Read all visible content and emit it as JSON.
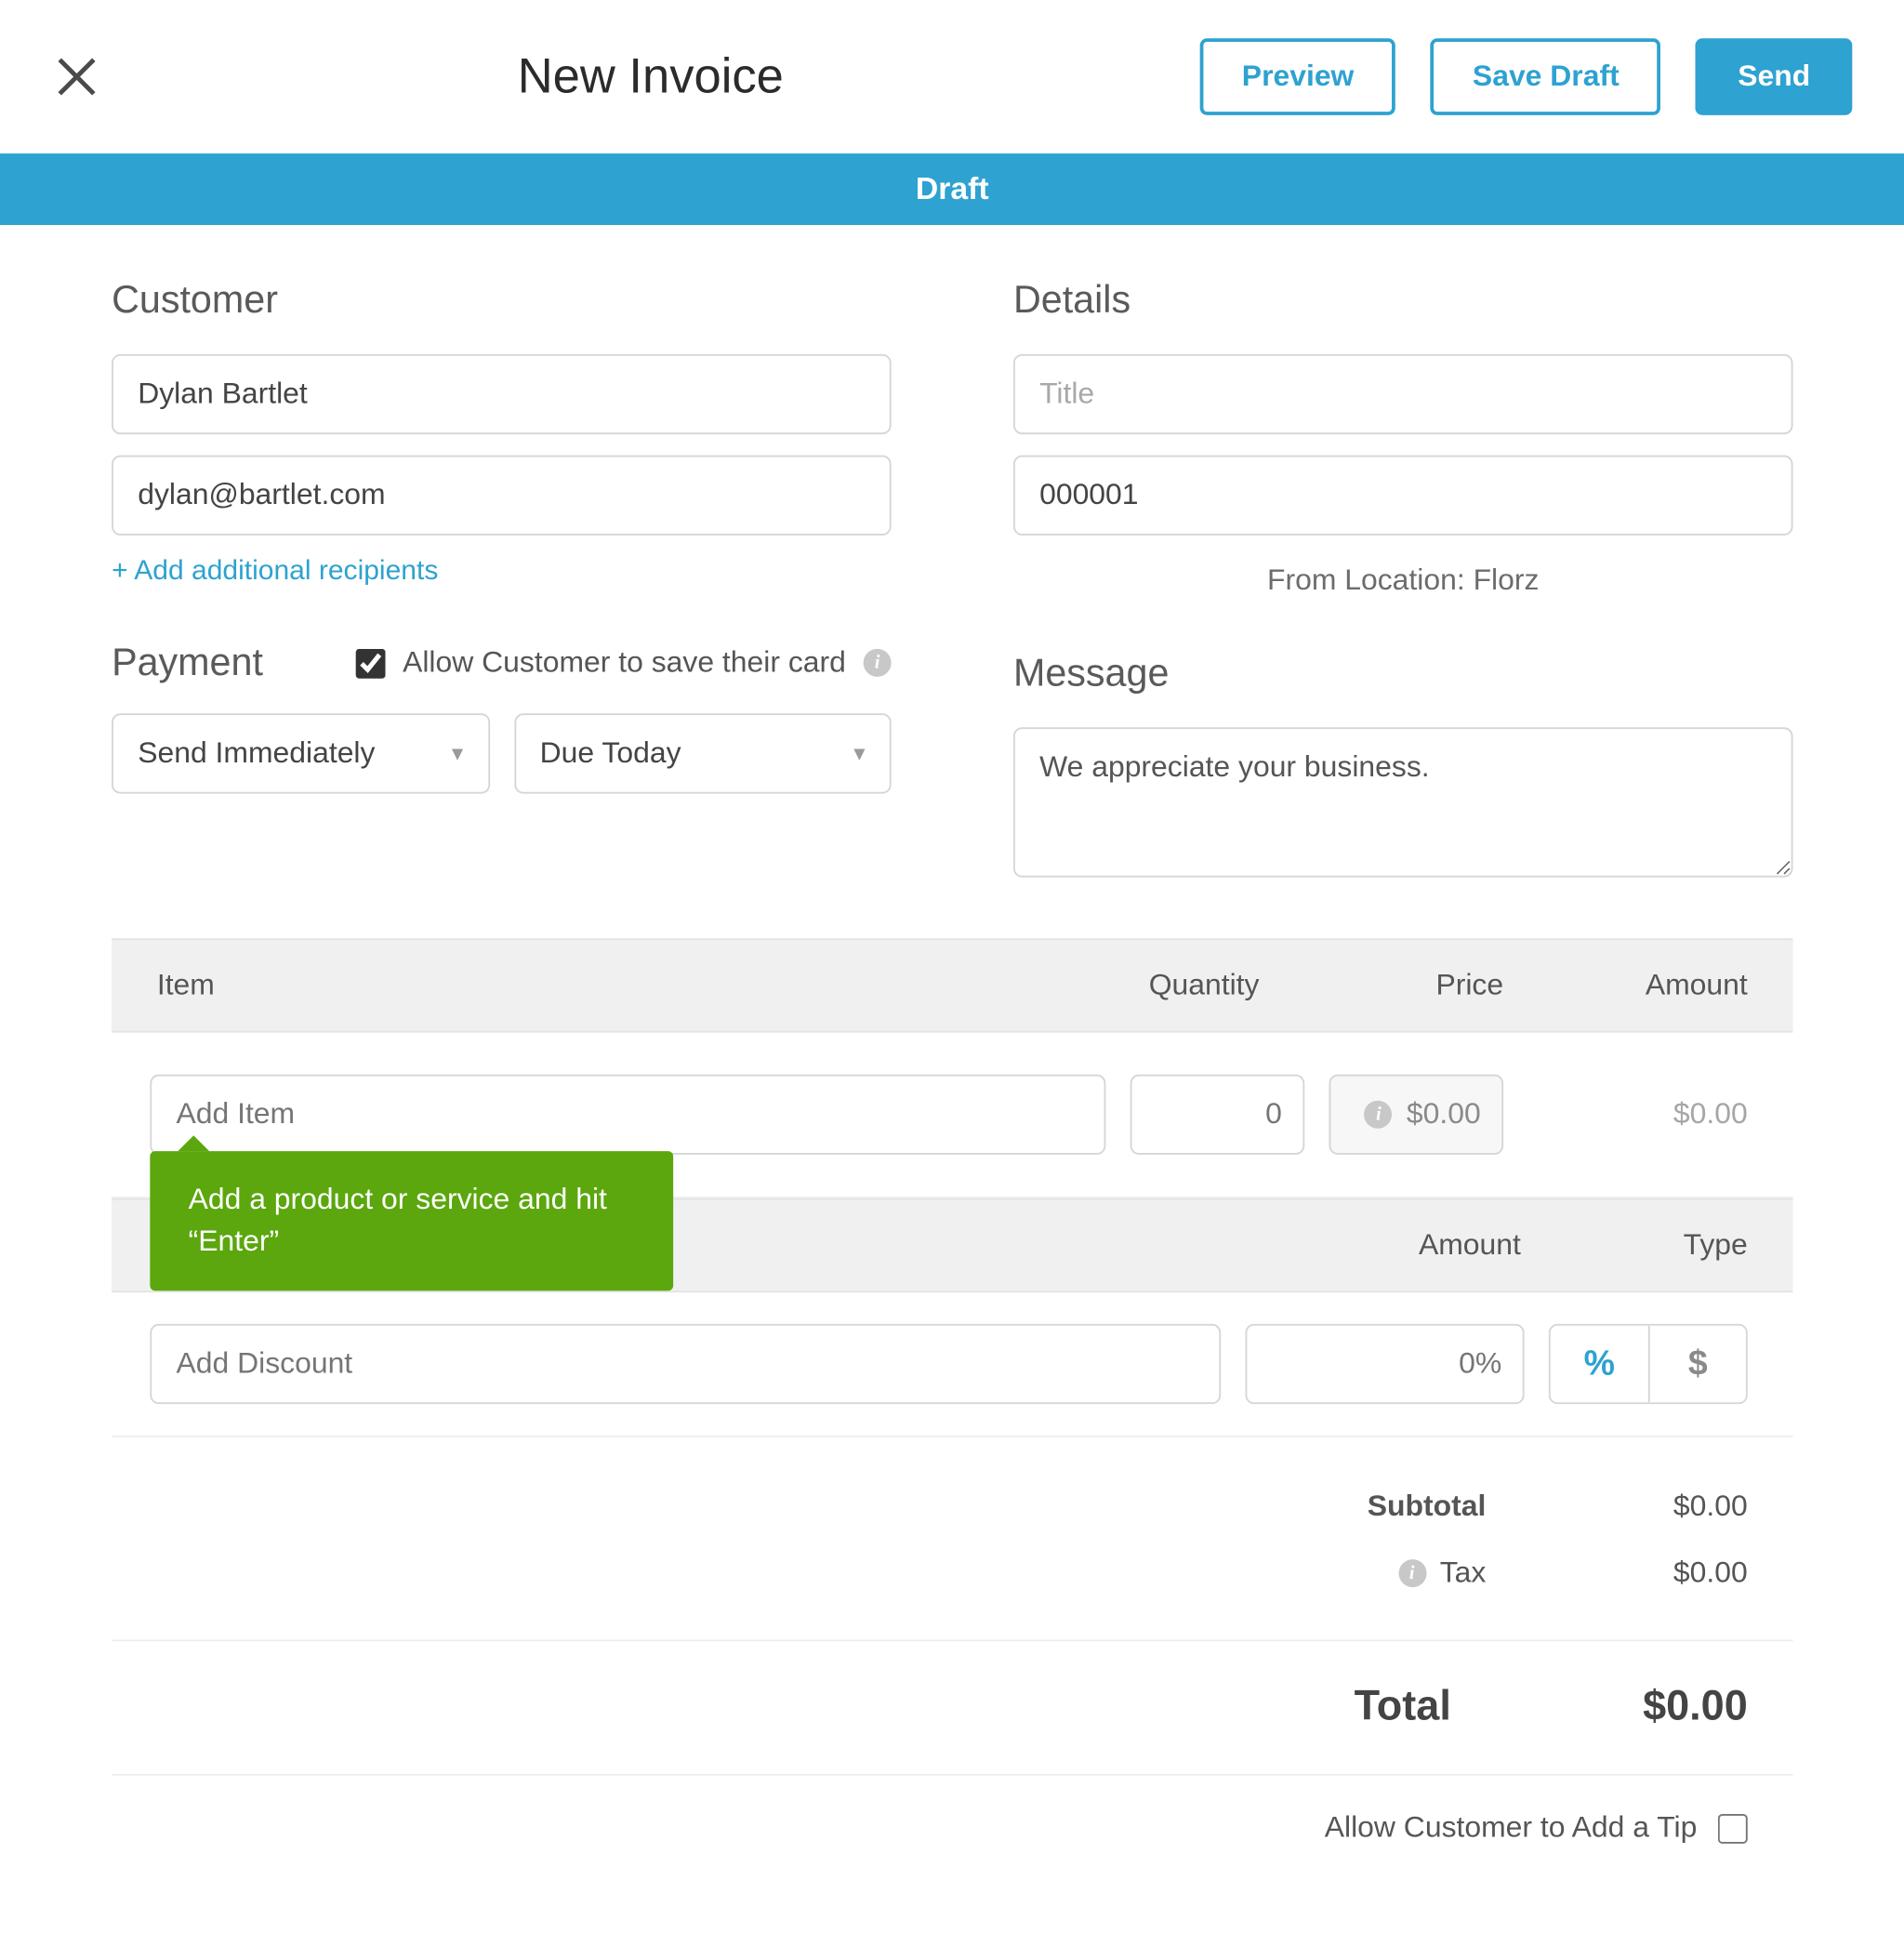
{
  "header": {
    "title": "New Invoice",
    "preview": "Preview",
    "save_draft": "Save Draft",
    "send": "Send"
  },
  "status": "Draft",
  "customer": {
    "heading": "Customer",
    "name": "Dylan Bartlet",
    "email": "dylan@bartlet.com",
    "add_recipients": "+ Add additional recipients"
  },
  "details": {
    "heading": "Details",
    "title_placeholder": "Title",
    "invoice_number": "000001",
    "from_location": "From Location: Florz"
  },
  "payment": {
    "heading": "Payment",
    "allow_save_card": "Allow Customer to save their card",
    "send_option": "Send Immediately",
    "due_option": "Due Today"
  },
  "message": {
    "heading": "Message",
    "value": "We appreciate your business."
  },
  "items": {
    "headers": {
      "item": "Item",
      "qty": "Quantity",
      "price": "Price",
      "amount": "Amount"
    },
    "add_item_placeholder": "Add Item",
    "qty_placeholder": "0",
    "price_value": "$0.00",
    "amount_value": "$0.00",
    "tooltip": "Add a product or service and hit “Enter”"
  },
  "discount": {
    "headers": {
      "amount": "Amount",
      "type": "Type"
    },
    "name_placeholder": "Add Discount",
    "amount_placeholder": "0%",
    "percent": "%",
    "dollar": "$"
  },
  "totals": {
    "subtotal_label": "Subtotal",
    "subtotal_value": "$0.00",
    "tax_label": "Tax",
    "tax_value": "$0.00",
    "total_label": "Total",
    "total_value": "$0.00"
  },
  "tip": {
    "label": "Allow Customer to Add a Tip"
  }
}
